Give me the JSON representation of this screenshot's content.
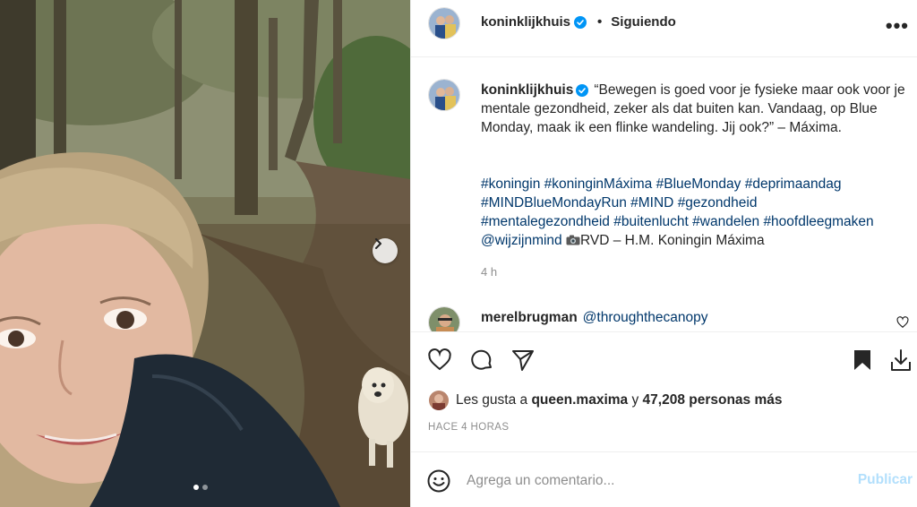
{
  "post": {
    "username": "koninklijkhuis",
    "follow_status": "Siguiendo",
    "more_icon": "more-horizontal-icon",
    "more_label": "•••"
  },
  "caption": {
    "username": "koninklijkhuis",
    "text": "“Bewegen is goed voor je fysieke maar ook voor je mentale gezondheid, zeker als dat buiten kan. Vandaag, op Blue Monday, maak ik een flinke wandeling. Jij ook?” – Máxima.",
    "hashtags": [
      "#koningin",
      "#koninginMáxima",
      "#BlueMonday",
      "#deprimaandag",
      "#MINDBlueMondayRun",
      "#MIND",
      "#gezondheid",
      "#mentalegezondheid",
      "#buitenlucht",
      "#wandelen",
      "#hoofdleegmaken"
    ],
    "mention": "@wijzijnmind",
    "credit": "RVD – H.M. Koningin Máxima",
    "time": "4 h"
  },
  "reply": {
    "username": "merelbrugman",
    "mention": "@throughthecanopy"
  },
  "likes": {
    "prefix": "Les gusta a",
    "liker": "queen.maxima",
    "joiner": "y",
    "others": "47,208 personas más"
  },
  "timestamp": "HACE 4 HORAS",
  "comment_box": {
    "placeholder": "Agrega un comentario...",
    "publish_label": "Publicar"
  },
  "carousel": {
    "total": 2,
    "current": 1
  },
  "colors": {
    "link": "#00376b",
    "verified": "#0095f6",
    "muted": "#8e8e8e",
    "publish_disabled": "#b2dffc",
    "border": "#efefef"
  }
}
